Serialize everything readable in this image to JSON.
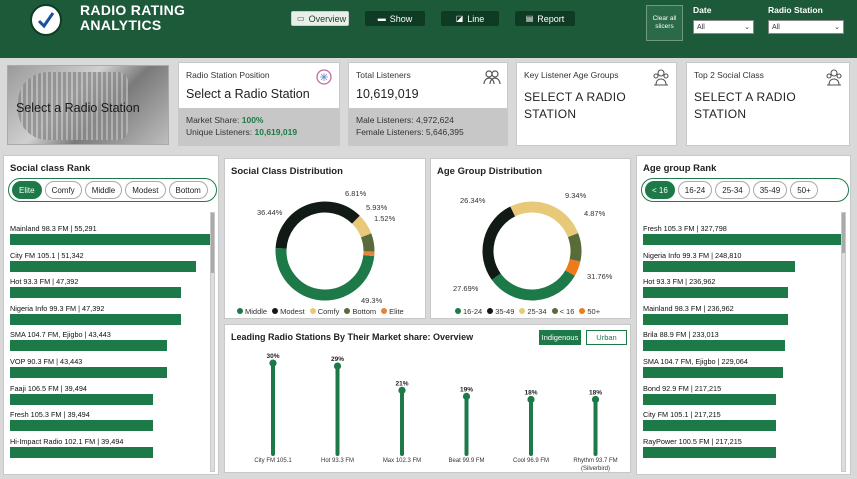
{
  "app": {
    "title": "RADIO RATING\nANALYTICS"
  },
  "nav": [
    {
      "label": "Overview",
      "icon": "overview-icon",
      "active": true
    },
    {
      "label": "Show",
      "icon": "show-icon",
      "active": false
    },
    {
      "label": "Line",
      "icon": "line-icon",
      "active": false
    },
    {
      "label": "Report",
      "icon": "report-icon",
      "active": false
    }
  ],
  "clear_button": {
    "label": "Clear all slicers"
  },
  "slicers": [
    {
      "label": "Date",
      "value": "All"
    },
    {
      "label": "Radio Station",
      "value": "All"
    }
  ],
  "hero": {
    "label": "Select a Radio Station"
  },
  "kpi_position": {
    "title": "Radio Station Position",
    "value": "Select a Radio Station",
    "line1_label": "Market Share: ",
    "line1_value": "100%",
    "line2_label": "Unique Listeners: ",
    "line2_value": "10,619,019"
  },
  "kpi_listeners": {
    "title": "Total Listeners",
    "value": "10,619,019",
    "male": "Male Listeners: 4,972,624",
    "female": "Female Listeners: 5,646,395"
  },
  "kpi_age": {
    "title": "Key Listener Age Groups",
    "value": "SELECT A RADIO\nSTATION"
  },
  "kpi_social": {
    "title": "Top 2 Social Class",
    "value": "SELECT A RADIO\nSTATION"
  },
  "social_rank": {
    "title": "Social class Rank",
    "pills": [
      "Elite",
      "Comfy",
      "Middle",
      "Modest",
      "Bottom"
    ],
    "selected": 0,
    "items": [
      {
        "label": "Mainland 98.3 FM | 55,291",
        "value": 55291
      },
      {
        "label": "City FM 105.1 | 51,342",
        "value": 51342
      },
      {
        "label": "Hot 93.3 FM | 47,392",
        "value": 47392
      },
      {
        "label": "Nigeria Info 99.3 FM | 47,392",
        "value": 47392
      },
      {
        "label": "SMA 104.7 FM, Ejigbo | 43,443",
        "value": 43443
      },
      {
        "label": "VOP 90.3 FM | 43,443",
        "value": 43443
      },
      {
        "label": "Faaji 106.5 FM | 39,494",
        "value": 39494
      },
      {
        "label": "Fresh 105.3 FM | 39,494",
        "value": 39494
      },
      {
        "label": "Hi-Impact Radio 102.1 FM | 39,494",
        "value": 39494
      }
    ]
  },
  "age_rank": {
    "title": "Age group Rank",
    "pills": [
      "< 16",
      "16-24",
      "25-34",
      "35-49",
      "50+"
    ],
    "selected": 0,
    "items": [
      {
        "label": "Fresh 105.3 FM | 327,798",
        "value": 327798
      },
      {
        "label": "Nigeria Info 99.3 FM | 248,810",
        "value": 248810
      },
      {
        "label": "Hot 93.3 FM | 236,962",
        "value": 236962
      },
      {
        "label": "Mainland 98.3 FM | 236,962",
        "value": 236962
      },
      {
        "label": "Brila 88.9 FM | 233,013",
        "value": 233013
      },
      {
        "label": "SMA 104.7 FM, Ejigbo | 229,064",
        "value": 229064
      },
      {
        "label": "Bond 92.9 FM | 217,215",
        "value": 217215
      },
      {
        "label": "City FM 105.1 | 217,215",
        "value": 217215
      },
      {
        "label": "RayPower 100.5 FM | 217,215",
        "value": 217215
      }
    ]
  },
  "chart_data": [
    {
      "type": "pie",
      "title": "Social Class Distribution",
      "labels": [
        "Middle",
        "Modest",
        "Comfy",
        "Bottom",
        "Elite"
      ],
      "values": [
        49.3,
        36.44,
        6.81,
        5.93,
        1.52
      ],
      "value_labels": [
        "49.3%",
        "36.44%",
        "6.81%",
        "5.93%",
        "1.52%"
      ],
      "colors": [
        "#1d7a48",
        "#111a14",
        "#e8c97a",
        "#5a6b3a",
        "#e8843a"
      ],
      "legend_position": "bottom"
    },
    {
      "type": "pie",
      "title": "Age Group Distribution",
      "labels": [
        "16-24",
        "35-49",
        "25-34",
        "< 16",
        "50+"
      ],
      "values": [
        31.76,
        27.69,
        26.34,
        9.34,
        4.87
      ],
      "value_labels": [
        "31.76%",
        "27.69%",
        "26.34%",
        "9.34%",
        "4.87%"
      ],
      "colors": [
        "#1d7a48",
        "#111a14",
        "#e8c97a",
        "#5a6b3a",
        "#f07a1a"
      ],
      "legend_position": "bottom"
    },
    {
      "type": "bar",
      "title": "Leading Radio Stations By Their Market share: Overview",
      "categories": [
        "City FM 105.1",
        "Hot 93.3 FM",
        "Max 102.3 FM",
        "Beat 99.9 FM",
        "Cool 96.9 FM",
        "Rhythm 93.7 FM\n(Silverbird)"
      ],
      "values": [
        30,
        29,
        21,
        19,
        18,
        18
      ],
      "value_labels": [
        "30%",
        "29%",
        "21%",
        "19%",
        "18%",
        "18%"
      ],
      "ylim": [
        0,
        32
      ],
      "color": "#1d7a48",
      "toggles": [
        {
          "label": "Indigenous",
          "selected": true
        },
        {
          "label": "Urban",
          "selected": false
        }
      ]
    }
  ]
}
